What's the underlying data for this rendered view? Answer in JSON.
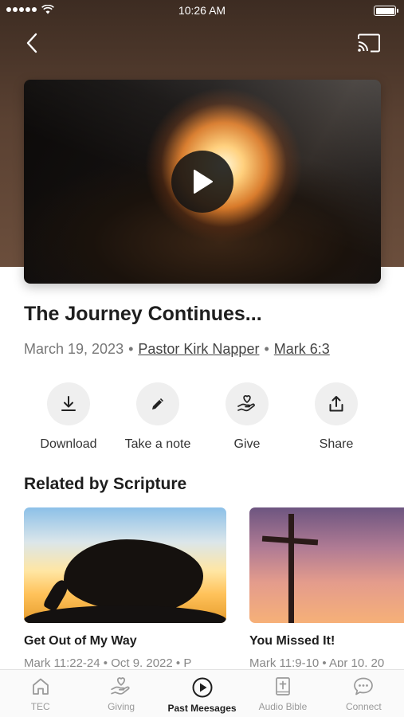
{
  "status_bar": {
    "time": "10:26 AM"
  },
  "header": {
    "back_icon": "chevron-left-icon",
    "cast_icon": "cast-icon"
  },
  "video": {
    "play_icon": "play-icon"
  },
  "message": {
    "title": "The Journey Continues...",
    "date": "March 19, 2023",
    "separator": "•",
    "speaker": "Pastor Kirk Napper",
    "scripture": "Mark 6:3"
  },
  "actions": [
    {
      "label": "Download",
      "icon": "download-icon"
    },
    {
      "label": "Take a note",
      "icon": "pencil-icon"
    },
    {
      "label": "Give",
      "icon": "hand-heart-icon"
    },
    {
      "label": "Share",
      "icon": "share-icon"
    }
  ],
  "related": {
    "title": "Related by Scripture",
    "items": [
      {
        "title": "Get Out of My Way",
        "meta": "Mark 11:22-24 • Oct 9, 2022 • P"
      },
      {
        "title": "You Missed It!",
        "meta": "Mark 11:9-10 • Apr 10, 20"
      }
    ]
  },
  "tabs": [
    {
      "label": "TEC",
      "icon": "home-icon",
      "active": false
    },
    {
      "label": "Giving",
      "icon": "hand-heart-icon",
      "active": false
    },
    {
      "label": "Past Meesages",
      "icon": "play-circle-icon",
      "active": true
    },
    {
      "label": "Audio Bible",
      "icon": "bible-icon",
      "active": false
    },
    {
      "label": "Connect",
      "icon": "chat-bubble-icon",
      "active": false
    }
  ],
  "colors": {
    "hero_brown": "#5a4132",
    "active_tab": "#1e1e1e",
    "inactive_tab": "#9a9a9a"
  }
}
